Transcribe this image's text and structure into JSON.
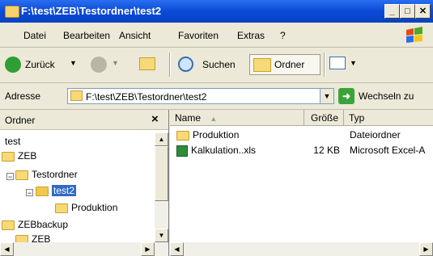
{
  "window": {
    "title": "F:\\test\\ZEB\\Testordner\\test2",
    "minimize_label": "_",
    "maximize_label": "□",
    "close_label": "✕"
  },
  "menu": [
    "Datei",
    "Bearbeiten",
    "Ansicht",
    "Favoriten",
    "Extras",
    "?"
  ],
  "toolbar": {
    "back_label": "Zurück",
    "search_label": "Suchen",
    "folders_label": "Ordner"
  },
  "address": {
    "label": "Adresse",
    "value": "F:\\test\\ZEB\\Testordner\\test2",
    "go_label": "Wechseln zu"
  },
  "folder_pane": {
    "title": "Ordner",
    "close": "×",
    "tree": [
      {
        "label": "test"
      },
      {
        "label": "ZEB"
      },
      {
        "label": "Testordner"
      },
      {
        "label": "test2"
      },
      {
        "label": "Produktion"
      },
      {
        "label": "ZEBbackup"
      },
      {
        "label": "ZEB"
      }
    ]
  },
  "file_list": {
    "columns": [
      "Name",
      "Größe",
      "Typ"
    ],
    "rows": [
      {
        "name": "Produktion",
        "size": "",
        "type": "Dateiordner"
      },
      {
        "name": "Kalkulation..xls",
        "size": "12 KB",
        "type": "Microsoft Excel-A"
      }
    ]
  },
  "colors": {
    "titlebar": "#0a4ad6",
    "selection": "#316ac5",
    "folder": "#f7d977"
  }
}
